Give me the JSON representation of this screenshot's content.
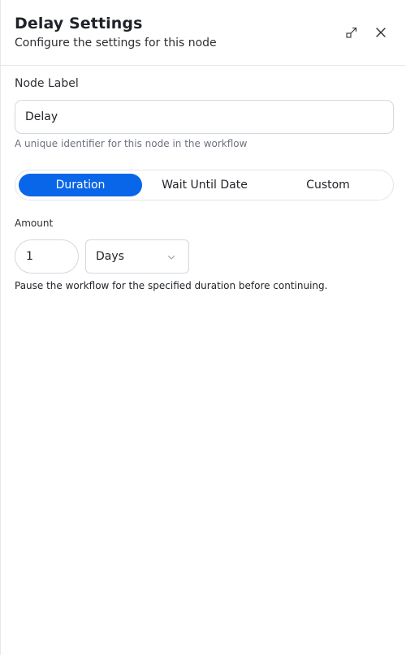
{
  "header": {
    "title": "Delay Settings",
    "subtitle": "Configure the settings for this node"
  },
  "node_label": {
    "label": "Node Label",
    "value": "Delay",
    "help": "A unique identifier for this node in the workflow"
  },
  "mode_tabs": {
    "selected": "Duration",
    "items": [
      {
        "label": "Duration"
      },
      {
        "label": "Wait Until Date"
      },
      {
        "label": "Custom"
      }
    ],
    "active_color": "#0a66e8"
  },
  "amount": {
    "label": "Amount",
    "value": "1",
    "unit_selected": "Days",
    "description": "Pause the workflow for the specified duration before continuing."
  },
  "icons": {
    "expand": "expand-icon",
    "close": "close-icon",
    "dropdown": "chevron-down-icon"
  }
}
